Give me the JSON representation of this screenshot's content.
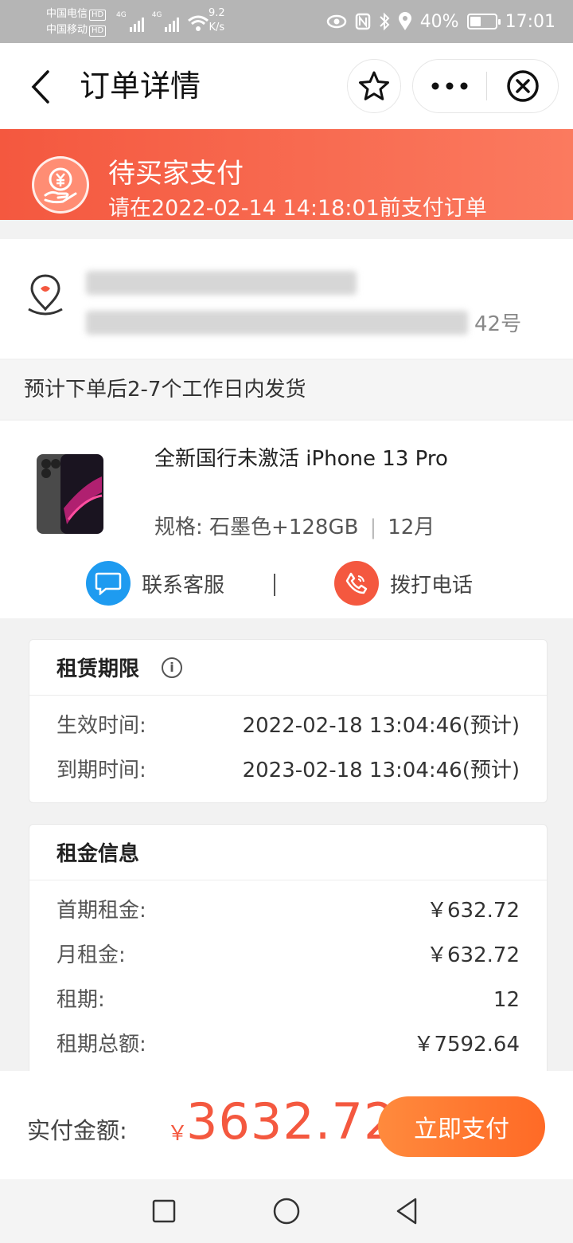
{
  "status_bar": {
    "carrier_1": "中国电信",
    "carrier_2": "中国移动",
    "hd": "HD",
    "net_1": "4G",
    "net_2": "4G",
    "speed_value": "9.2",
    "speed_unit": "K/s",
    "battery": "40%",
    "time": "17:01"
  },
  "header": {
    "title": "订单详情",
    "icons": [
      "back-icon",
      "star-icon",
      "more-icon",
      "close-icon"
    ]
  },
  "banner": {
    "title": "待买家支付",
    "subtitle": "请在2022-02-14 14:18:01前支付订单",
    "icon": "yen-hand-icon"
  },
  "address": {
    "visible_suffix": "42号"
  },
  "shipping": {
    "text": "预计下单后2-7个工作日内发货"
  },
  "product": {
    "name": "全新国行未激活 iPhone 13 Pro",
    "spec_prefix": "规格: ",
    "spec_value": "石墨色+128GB",
    "term": "12月",
    "contact_label": "联系客服",
    "call_label": "拨打电话"
  },
  "lease_period": {
    "title": "租赁期限",
    "rows": [
      {
        "label": "生效时间:",
        "value": "2022-02-18 13:04:46(预计)"
      },
      {
        "label": "到期时间:",
        "value": "2023-02-18 13:04:46(预计)"
      }
    ]
  },
  "rent_info": {
    "title": "租金信息",
    "rows": [
      {
        "label": "首期租金:",
        "value": "￥632.72"
      },
      {
        "label": "月租金:",
        "value": "￥632.72"
      },
      {
        "label": "租期:",
        "value": "12"
      },
      {
        "label": "租期总额:",
        "value": "￥7592.64"
      }
    ]
  },
  "payment": {
    "label": "实付金额:",
    "currency": "￥",
    "amount": "3632.72",
    "button": "立即支付"
  },
  "colors": {
    "accent_red": "#f4583f",
    "accent_orange": "#ff7a30",
    "chat_blue": "#1e9bf0"
  }
}
